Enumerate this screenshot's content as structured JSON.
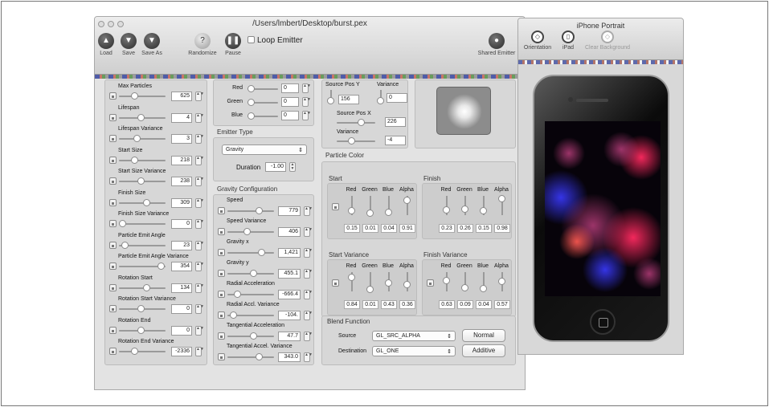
{
  "window": {
    "title": "/Users/lmbert/Desktop/burst.pex",
    "toolbar": {
      "load": "Load",
      "save": "Save",
      "save_as": "Save As",
      "randomize": "Randomize",
      "pause": "Pause",
      "loop_emitter": "Loop Emitter",
      "shared_emitter": "Shared Emitter"
    }
  },
  "left_params": [
    {
      "label": "Max Particles",
      "value": "625",
      "knob": 0.3
    },
    {
      "label": "Lifespan",
      "value": "4",
      "knob": 0.45
    },
    {
      "label": "Lifespan Variance",
      "value": "3",
      "knob": 0.35
    },
    {
      "label": "Start Size",
      "value": "218",
      "knob": 0.3
    },
    {
      "label": "Start Size Variance",
      "value": "238",
      "knob": 0.45
    },
    {
      "label": "Finish Size",
      "value": "309",
      "knob": 0.6
    },
    {
      "label": "Finish Size Variance",
      "value": "0",
      "knob": 0.0
    },
    {
      "label": "Particle Emit Angle",
      "value": "23",
      "knob": 0.05
    },
    {
      "label": "Particle Emit Angle Variance",
      "value": "354",
      "knob": 0.95
    },
    {
      "label": "Rotation Start",
      "value": "134",
      "knob": 0.6
    },
    {
      "label": "Rotation Start Variance",
      "value": "0",
      "knob": 0.45
    },
    {
      "label": "Rotation End",
      "value": "0",
      "knob": 0.45
    },
    {
      "label": "Rotation End Variance",
      "value": "-2336",
      "knob": 0.3
    }
  ],
  "color": {
    "rows": [
      {
        "label": "Red",
        "value": "0"
      },
      {
        "label": "Green",
        "value": "0"
      },
      {
        "label": "Blue",
        "value": "0"
      }
    ]
  },
  "emitter_type": {
    "title": "Emitter Type",
    "selected": "Gravity",
    "duration_label": "Duration",
    "duration_value": "-1.00"
  },
  "gravity": {
    "title": "Gravity Configuration",
    "params": [
      {
        "label": "Speed",
        "value": "779",
        "knob": 0.7
      },
      {
        "label": "Speed Variance",
        "value": "406",
        "knob": 0.4
      },
      {
        "label": "Gravity x",
        "value": "1,421",
        "knob": 0.75
      },
      {
        "label": "Gravity y",
        "value": "455.1",
        "knob": 0.55
      },
      {
        "label": "Radial Acceleration",
        "value": "-666.4",
        "knob": 0.15
      },
      {
        "label": "Radial Accl. Variance",
        "value": "-104.",
        "knob": 0.05
      },
      {
        "label": "Tangential Acceleration",
        "value": "47.7",
        "knob": 0.55
      },
      {
        "label": "Tangential Accel. Variance",
        "value": "343.0",
        "knob": 0.7
      }
    ]
  },
  "source": {
    "pos_y_label": "Source Pos Y",
    "pos_y_value": "156",
    "variance_label": "Variance",
    "variance_value": "0",
    "pos_x_label": "Source Pos X",
    "pos_x_value": "226",
    "x_variance_label": "Variance",
    "x_variance_value": "-4"
  },
  "particle_color": {
    "title": "Particle Color",
    "channels": [
      "Red",
      "Green",
      "Blue",
      "Alpha"
    ],
    "groups": [
      {
        "title": "Start",
        "values": [
          "0.15",
          "0.01",
          "0.04",
          "0.91"
        ],
        "levels": [
          0.15,
          0.01,
          0.04,
          0.91
        ],
        "lock": true
      },
      {
        "title": "Finish",
        "values": [
          "0.23",
          "0.26",
          "0.15",
          "0.98"
        ],
        "levels": [
          0.23,
          0.26,
          0.15,
          0.98
        ],
        "lock": false
      },
      {
        "title": "Start Variance",
        "values": [
          "0.84",
          "0.01",
          "0.43",
          "0.36"
        ],
        "levels": [
          0.84,
          0.01,
          0.43,
          0.36
        ],
        "lock": true
      },
      {
        "title": "Finish Variance",
        "values": [
          "0.63",
          "0.09",
          "0.04",
          "0.57"
        ],
        "levels": [
          0.63,
          0.09,
          0.04,
          0.57
        ],
        "lock": true
      }
    ]
  },
  "blend": {
    "title": "Blend Function",
    "source_label": "Source",
    "source_value": "GL_SRC_ALPHA",
    "dest_label": "Destination",
    "dest_value": "GL_ONE",
    "normal": "Normal",
    "additive": "Additive"
  },
  "preview": {
    "title": "iPhone Portrait",
    "orientation": "Orientation",
    "ipad": "iPad",
    "clear_background": "Clear Background"
  }
}
